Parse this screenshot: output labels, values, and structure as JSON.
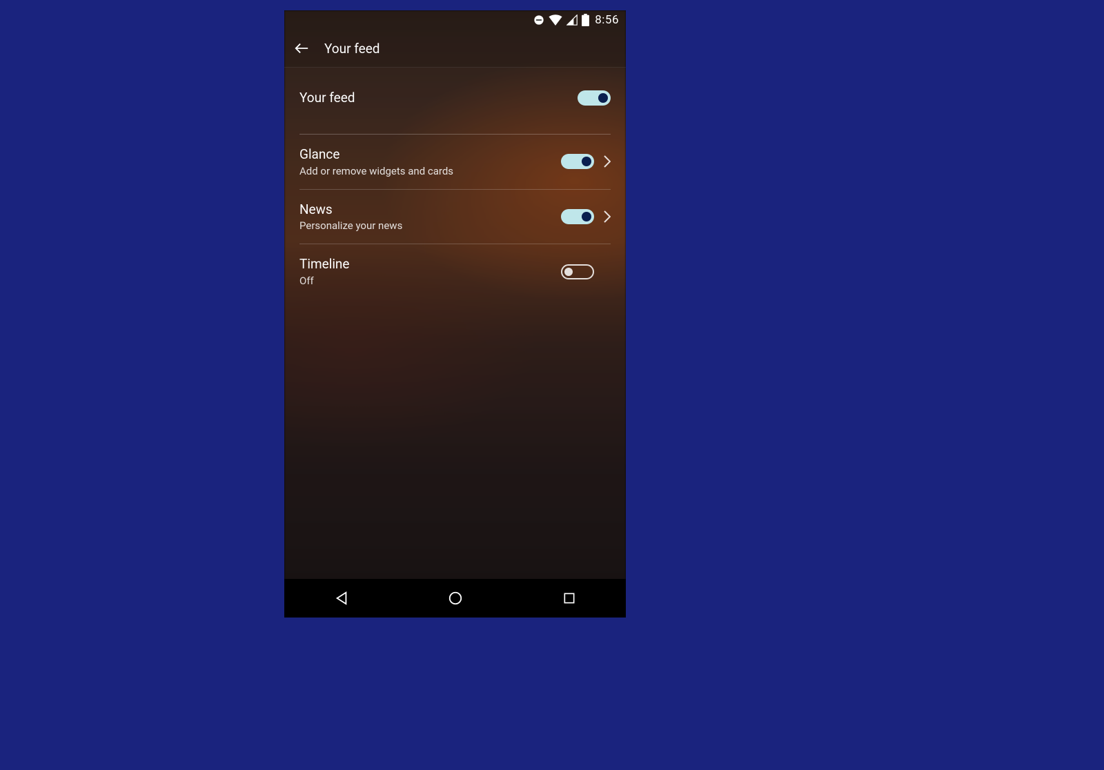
{
  "status": {
    "time": "8:56"
  },
  "appbar": {
    "title": "Your feed"
  },
  "feed_main": {
    "title": "Your feed",
    "toggle_on": true
  },
  "items": [
    {
      "title": "Glance",
      "subtitle": "Add or remove widgets and cards",
      "toggle_on": true,
      "chevron": true
    },
    {
      "title": "News",
      "subtitle": "Personalize your news",
      "toggle_on": true,
      "chevron": true
    },
    {
      "title": "Timeline",
      "subtitle": "Off",
      "toggle_on": false,
      "chevron": false
    }
  ]
}
